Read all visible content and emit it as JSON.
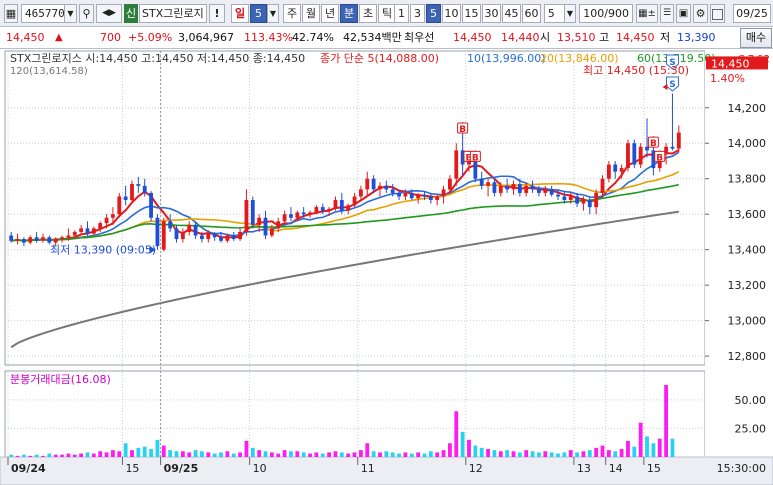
{
  "toolbar": {
    "code": "465770",
    "search_icon": "magnifier-icon",
    "market_badge": "신",
    "stock_name": "STX그린로지",
    "period_buttons": [
      "일",
      "주",
      "월",
      "년",
      "분",
      "초",
      "틱"
    ],
    "active_period": "분",
    "day_count": "5",
    "intervals": [
      "1",
      "3",
      "5",
      "10",
      "15",
      "30",
      "45",
      "60"
    ],
    "active_interval": "5",
    "interval_select": "5",
    "count_display": "100/900",
    "date": "09/25"
  },
  "info": {
    "price": "14,450",
    "arrow": "▲",
    "change": "700",
    "change_pct": "+5.09%",
    "volume": "3,064,967",
    "vol_ratio": "113.43%",
    "rate2": "42.74%",
    "amount": "42,534백만",
    "best_label": "최우선",
    "best_ask": "14,450",
    "best_bid": "14,440",
    "open_label": "시",
    "open": "13,510",
    "high_label": "고",
    "high": "14,450",
    "low_label": "저",
    "low": "13,390",
    "buy_button": "매수"
  },
  "chart_data": {
    "type": "candlestick",
    "title": "STX그린로지스 시:14,450 고:14,450 저:14,450 종:14,450",
    "legend": [
      {
        "label": "종가 단순 5(14,088.00)",
        "color": "#e31a1c"
      },
      {
        "label": "10(13,996.00)",
        "color": "#2b6cd6"
      },
      {
        "label": "20(13,846.00)",
        "color": "#e6a100"
      },
      {
        "label": "60(13,719.50)",
        "color": "#1f9a1f"
      },
      {
        "label": "",
        "color": "#777777"
      }
    ],
    "prev_label": "120(13,614.58)",
    "ylim": [
      12750,
      14520
    ],
    "y_ticks": [
      "14,200",
      "14,000",
      "13,800",
      "13,600",
      "13,400",
      "13,200",
      "13,000",
      "12,800"
    ],
    "y_tick_values": [
      14200,
      14000,
      13800,
      13600,
      13400,
      13200,
      13000,
      12800
    ],
    "right_top_labels": [
      "C 7.92",
      "1.40%"
    ],
    "current_price_label": "14,450",
    "current_price": 14450,
    "max_annotation": "최고 14,450 (15:30)",
    "min_annotation": "최저 13,390 (09:05)",
    "candles": [
      [
        13480,
        13500,
        13440,
        13450
      ],
      [
        13450,
        13490,
        13430,
        13460
      ],
      [
        13460,
        13470,
        13420,
        13440
      ],
      [
        13440,
        13480,
        13430,
        13470
      ],
      [
        13470,
        13500,
        13440,
        13450
      ],
      [
        13450,
        13490,
        13440,
        13470
      ],
      [
        13470,
        13480,
        13430,
        13440
      ],
      [
        13440,
        13470,
        13420,
        13460
      ],
      [
        13460,
        13480,
        13440,
        13470
      ],
      [
        13470,
        13520,
        13450,
        13480
      ],
      [
        13480,
        13510,
        13460,
        13500
      ],
      [
        13500,
        13540,
        13480,
        13520
      ],
      [
        13520,
        13560,
        13480,
        13490
      ],
      [
        13490,
        13530,
        13480,
        13520
      ],
      [
        13520,
        13560,
        13500,
        13550
      ],
      [
        13550,
        13600,
        13520,
        13580
      ],
      [
        13580,
        13640,
        13540,
        13600
      ],
      [
        13600,
        13720,
        13580,
        13700
      ],
      [
        13700,
        13760,
        13650,
        13680
      ],
      [
        13680,
        13790,
        13660,
        13770
      ],
      [
        13770,
        13810,
        13720,
        13760
      ],
      [
        13760,
        13800,
        13700,
        13720
      ],
      [
        13720,
        13730,
        13560,
        13580
      ],
      [
        13580,
        13600,
        13400,
        13420
      ],
      [
        13400,
        13580,
        13390,
        13560
      ],
      [
        13560,
        13600,
        13500,
        13520
      ],
      [
        13520,
        13540,
        13440,
        13460
      ],
      [
        13460,
        13520,
        13440,
        13500
      ],
      [
        13500,
        13560,
        13480,
        13540
      ],
      [
        13540,
        13560,
        13460,
        13480
      ],
      [
        13480,
        13500,
        13440,
        13460
      ],
      [
        13460,
        13510,
        13440,
        13490
      ],
      [
        13490,
        13500,
        13450,
        13470
      ],
      [
        13470,
        13500,
        13440,
        13450
      ],
      [
        13450,
        13490,
        13440,
        13480
      ],
      [
        13480,
        13500,
        13450,
        13460
      ],
      [
        13460,
        13520,
        13450,
        13500
      ],
      [
        13500,
        13740,
        13480,
        13680
      ],
      [
        13680,
        13700,
        13520,
        13540
      ],
      [
        13540,
        13600,
        13500,
        13580
      ],
      [
        13580,
        13620,
        13460,
        13480
      ],
      [
        13480,
        13540,
        13470,
        13520
      ],
      [
        13520,
        13580,
        13500,
        13560
      ],
      [
        13560,
        13620,
        13540,
        13600
      ],
      [
        13600,
        13640,
        13560,
        13580
      ],
      [
        13580,
        13620,
        13560,
        13610
      ],
      [
        13610,
        13640,
        13580,
        13600
      ],
      [
        13600,
        13620,
        13580,
        13610
      ],
      [
        13610,
        13650,
        13600,
        13640
      ],
      [
        13640,
        13660,
        13600,
        13620
      ],
      [
        13620,
        13640,
        13590,
        13630
      ],
      [
        13630,
        13700,
        13620,
        13680
      ],
      [
        13680,
        13720,
        13600,
        13620
      ],
      [
        13620,
        13660,
        13600,
        13650
      ],
      [
        13650,
        13720,
        13640,
        13700
      ],
      [
        13700,
        13760,
        13680,
        13740
      ],
      [
        13740,
        13840,
        13700,
        13800
      ],
      [
        13800,
        13820,
        13720,
        13740
      ],
      [
        13740,
        13780,
        13700,
        13760
      ],
      [
        13760,
        13790,
        13720,
        13740
      ],
      [
        13740,
        13770,
        13700,
        13720
      ],
      [
        13720,
        13740,
        13680,
        13700
      ],
      [
        13700,
        13740,
        13680,
        13720
      ],
      [
        13720,
        13740,
        13680,
        13690
      ],
      [
        13690,
        13720,
        13660,
        13710
      ],
      [
        13710,
        13730,
        13680,
        13700
      ],
      [
        13700,
        13720,
        13660,
        13680
      ],
      [
        13680,
        13710,
        13650,
        13700
      ],
      [
        13700,
        13760,
        13660,
        13740
      ],
      [
        13740,
        13820,
        13720,
        13800
      ],
      [
        13800,
        14000,
        13760,
        13960
      ],
      [
        13960,
        14120,
        13820,
        13880
      ],
      [
        13880,
        13960,
        13840,
        13940
      ],
      [
        13940,
        13960,
        13780,
        13800
      ],
      [
        13800,
        13840,
        13740,
        13760
      ],
      [
        13760,
        13800,
        13700,
        13780
      ],
      [
        13780,
        13800,
        13700,
        13720
      ],
      [
        13720,
        13780,
        13700,
        13760
      ],
      [
        13760,
        13800,
        13720,
        13740
      ],
      [
        13740,
        13790,
        13710,
        13770
      ],
      [
        13770,
        13800,
        13700,
        13720
      ],
      [
        13720,
        13780,
        13700,
        13760
      ],
      [
        13760,
        13790,
        13720,
        13740
      ],
      [
        13740,
        13760,
        13700,
        13720
      ],
      [
        13720,
        13760,
        13700,
        13740
      ],
      [
        13740,
        13760,
        13700,
        13710
      ],
      [
        13710,
        13740,
        13680,
        13700
      ],
      [
        13700,
        13730,
        13660,
        13680
      ],
      [
        13680,
        13720,
        13660,
        13700
      ],
      [
        13700,
        13720,
        13640,
        13660
      ],
      [
        13660,
        13700,
        13620,
        13680
      ],
      [
        13680,
        13700,
        13600,
        13640
      ],
      [
        13640,
        13740,
        13600,
        13720
      ],
      [
        13720,
        13820,
        13700,
        13800
      ],
      [
        13800,
        13900,
        13780,
        13880
      ],
      [
        13880,
        13900,
        13800,
        13840
      ],
      [
        13840,
        13880,
        13800,
        13860
      ],
      [
        13860,
        14020,
        13840,
        14000
      ],
      [
        14000,
        14020,
        13860,
        13880
      ],
      [
        13880,
        14000,
        13860,
        13980
      ],
      [
        13980,
        14140,
        13920,
        13960
      ],
      [
        13960,
        14040,
        13820,
        13860
      ],
      [
        13860,
        13960,
        13840,
        13940
      ],
      [
        13940,
        14000,
        13880,
        13980
      ],
      [
        13980,
        14280,
        13960,
        13970
      ],
      [
        13970,
        14100,
        13950,
        14060
      ]
    ],
    "ma_last": {
      "ma5": 14088.0,
      "ma10": 13996.0,
      "ma20": 13846.0,
      "ma60": 13719.5,
      "ma120": 13614.58
    },
    "volume_ticks": [
      "50.00",
      "25.00"
    ],
    "volume_tick_values": [
      50,
      25
    ],
    "volume_title": "분봉거래대금(16.08)",
    "volume_ymax": 63,
    "volume": [
      2,
      1,
      2,
      1,
      2,
      1,
      3,
      2,
      2,
      3,
      2,
      3,
      4,
      3,
      5,
      4,
      6,
      5,
      12,
      6,
      8,
      9,
      7,
      15,
      10,
      6,
      5,
      5,
      4,
      6,
      5,
      4,
      3,
      4,
      5,
      3,
      4,
      14,
      8,
      6,
      5,
      4,
      3,
      6,
      5,
      5,
      4,
      3,
      4,
      3,
      4,
      5,
      4,
      3,
      4,
      6,
      12,
      5,
      4,
      5,
      4,
      3,
      4,
      3,
      4,
      3,
      5,
      4,
      6,
      12,
      40,
      22,
      15,
      10,
      8,
      7,
      6,
      5,
      6,
      5,
      4,
      6,
      5,
      4,
      5,
      4,
      3,
      4,
      6,
      4,
      5,
      6,
      8,
      10,
      6,
      5,
      7,
      14,
      9,
      30,
      18,
      12,
      16,
      63,
      16
    ],
    "volume_colors_note": "magenta=up, cyan=down",
    "x_labels": [
      {
        "i": 0,
        "label": "09/24",
        "bold": true
      },
      {
        "i": 18,
        "label": "15",
        "bold": false
      },
      {
        "i": 24,
        "label": "09/25",
        "bold": true
      },
      {
        "i": 38,
        "label": "10",
        "bold": false
      },
      {
        "i": 55,
        "label": "11",
        "bold": false
      },
      {
        "i": 72,
        "label": "12",
        "bold": false
      },
      {
        "i": 89,
        "label": "13",
        "bold": false
      },
      {
        "i": 94,
        "label": "14",
        "bold": false
      },
      {
        "i": 100,
        "label": "15",
        "bold": false
      }
    ],
    "time_label": "15:30:00",
    "bounce_markers": [
      71,
      72,
      73,
      101,
      102
    ],
    "s_marker_label": "S"
  }
}
